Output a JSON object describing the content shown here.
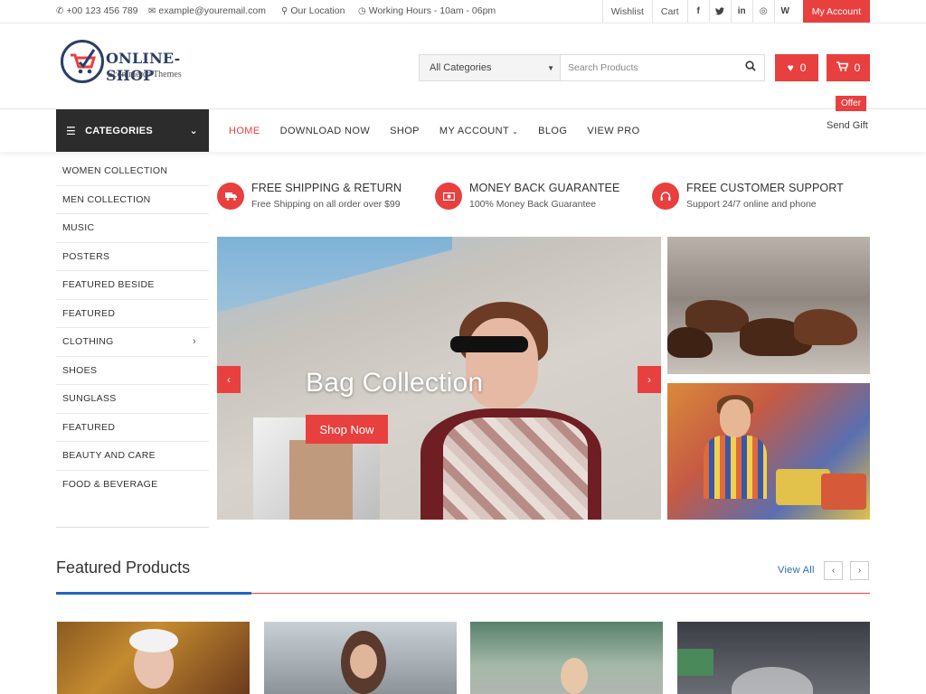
{
  "topbar": {
    "phone": "+00 123 456 789",
    "email": "example@youremail.com",
    "location": "Our Location",
    "hours": "Working Hours - 10am - 06pm",
    "wishlist": "Wishlist",
    "cart": "Cart",
    "my_account": "My Account",
    "social": [
      {
        "name": "facebook-icon",
        "glyph": "f"
      },
      {
        "name": "twitter-icon",
        "glyph": "t"
      },
      {
        "name": "linkedin-icon",
        "glyph": "in"
      },
      {
        "name": "instagram-icon",
        "glyph": "◎"
      },
      {
        "name": "wordpress-icon",
        "glyph": "W"
      }
    ]
  },
  "header": {
    "logo_title": "ONLINE-SHOP",
    "logo_subtitle": "Ecommerce Themes",
    "category_select": "All Categories",
    "search_placeholder": "Search Products",
    "wishlist_count": "0",
    "cart_count": "0"
  },
  "nav": {
    "categories_label": "CATEGORIES",
    "items": [
      "HOME",
      "DOWNLOAD NOW",
      "SHOP",
      "MY ACCOUNT",
      "BLOG",
      "VIEW PRO"
    ],
    "offer_badge": "Offer",
    "send_gift": "Send Gift"
  },
  "sidebar": {
    "items": [
      "WOMEN COLLECTION",
      "MEN COLLECTION",
      "MUSIC",
      "POSTERS",
      "FEATURED BESIDE",
      "FEATURED",
      "CLOTHING",
      "SHOES",
      "SUNGLASS",
      "FEATURED",
      "BEAUTY AND CARE",
      "FOOD & BEVERAGE"
    ]
  },
  "features": [
    {
      "title": "FREE SHIPPING & RETURN",
      "subtitle": "Free Shipping on all order over $99",
      "icon": "truck-icon"
    },
    {
      "title": "MONEY BACK GUARANTEE",
      "subtitle": "100% Money Back Guarantee",
      "icon": "money-icon"
    },
    {
      "title": "FREE CUSTOMER SUPPORT",
      "subtitle": "Support 24/7 online and phone",
      "icon": "headset-icon"
    }
  ],
  "hero": {
    "title": "Bag Collection",
    "button": "Shop Now"
  },
  "featured": {
    "title": "Featured Products",
    "view_all": "View All"
  },
  "colors": {
    "accent": "#e8403f",
    "dark": "#2c2c2c",
    "link": "#2a6db5"
  }
}
